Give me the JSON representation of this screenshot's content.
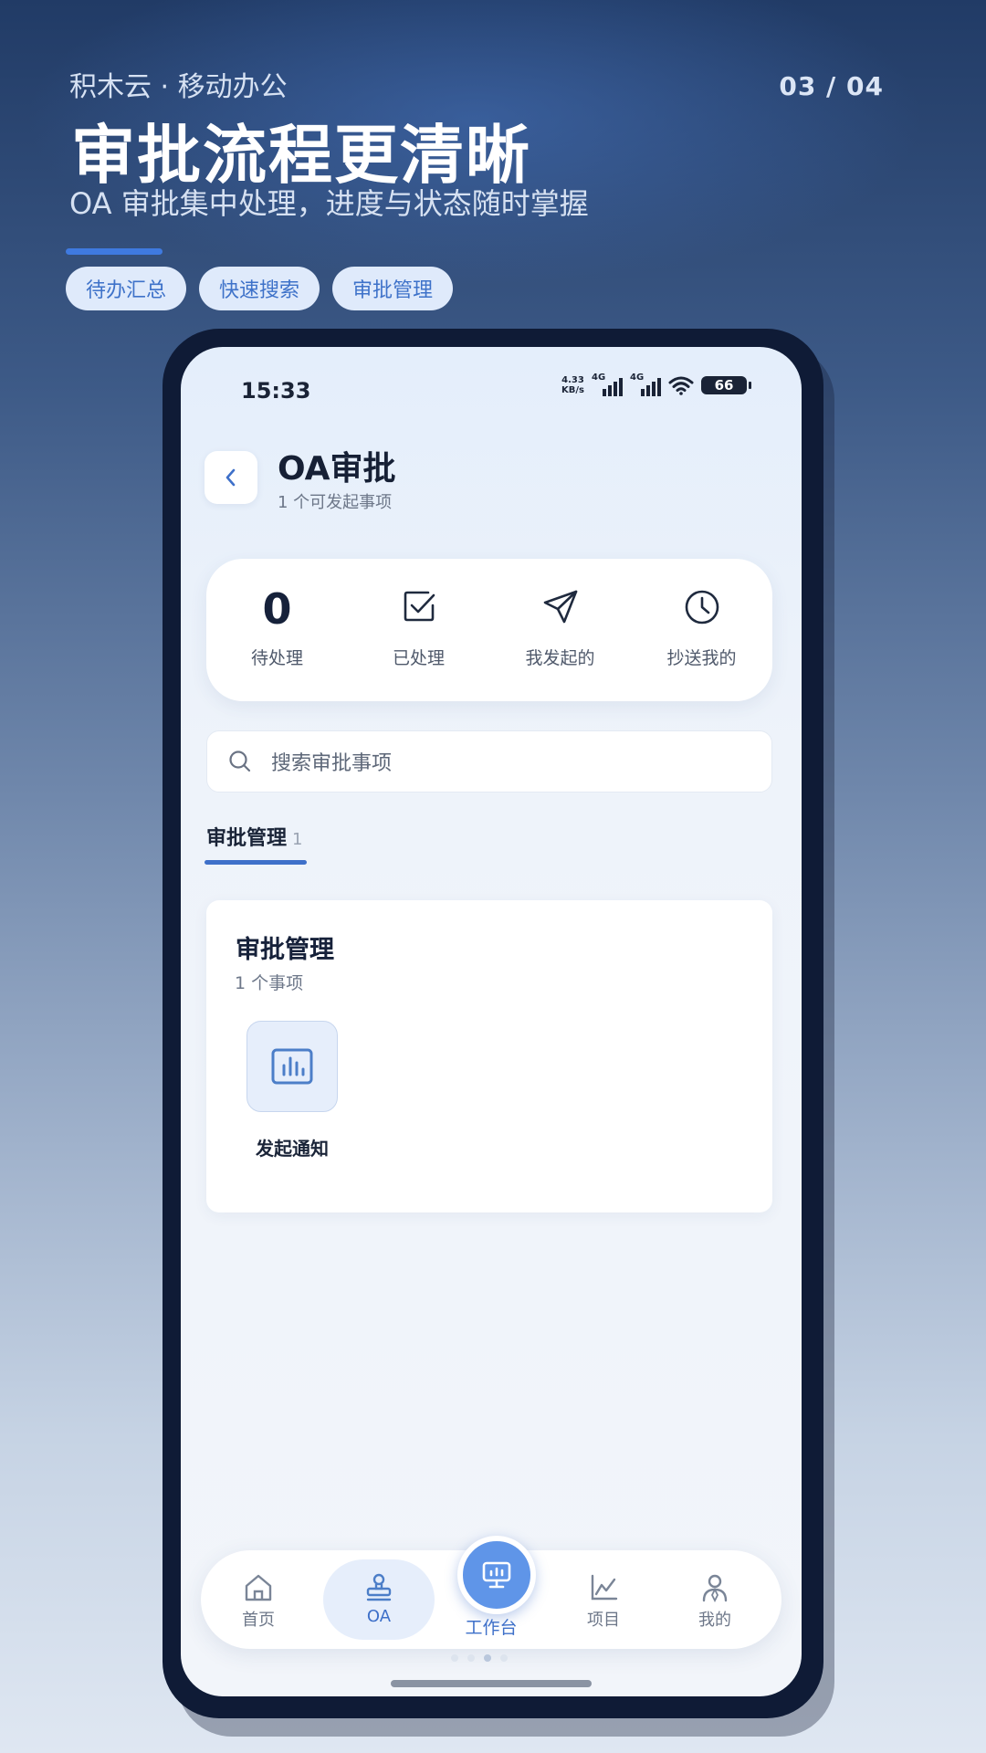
{
  "banner": {
    "brand": "积木云 · 移动办公",
    "pager": "03 / 04",
    "headline": "审批流程更清晰",
    "subheadline": "OA 审批集中处理，进度与状态随时掌握",
    "chips": [
      "待办汇总",
      "快速搜索",
      "审批管理"
    ]
  },
  "status_bar": {
    "time": "15:33",
    "net_speed_value": "4.33",
    "net_speed_unit": "KB/s",
    "signal_1": "4G",
    "signal_2": "4G",
    "battery": "66"
  },
  "header": {
    "title": "OA审批",
    "subtitle": "1 个可发起事项"
  },
  "stats": {
    "pending_value": "0",
    "pending_label": "待处理",
    "processed_label": "已处理",
    "initiated_label": "我发起的",
    "cc_label": "抄送我的"
  },
  "search": {
    "placeholder": "搜索审批事项"
  },
  "tab": {
    "label": "审批管理",
    "count": "1"
  },
  "group": {
    "title": "审批管理",
    "subtitle": "1 个事项",
    "items": [
      {
        "label": "发起通知",
        "icon": "chart-icon"
      }
    ]
  },
  "nav": {
    "home": "首页",
    "oa": "OA",
    "workbench": "工作台",
    "projects": "项目",
    "mine": "我的"
  },
  "colors": {
    "accent": "#3e70c9",
    "nav_center": "#5f95e8",
    "chip_bg": "#dfeafb"
  }
}
